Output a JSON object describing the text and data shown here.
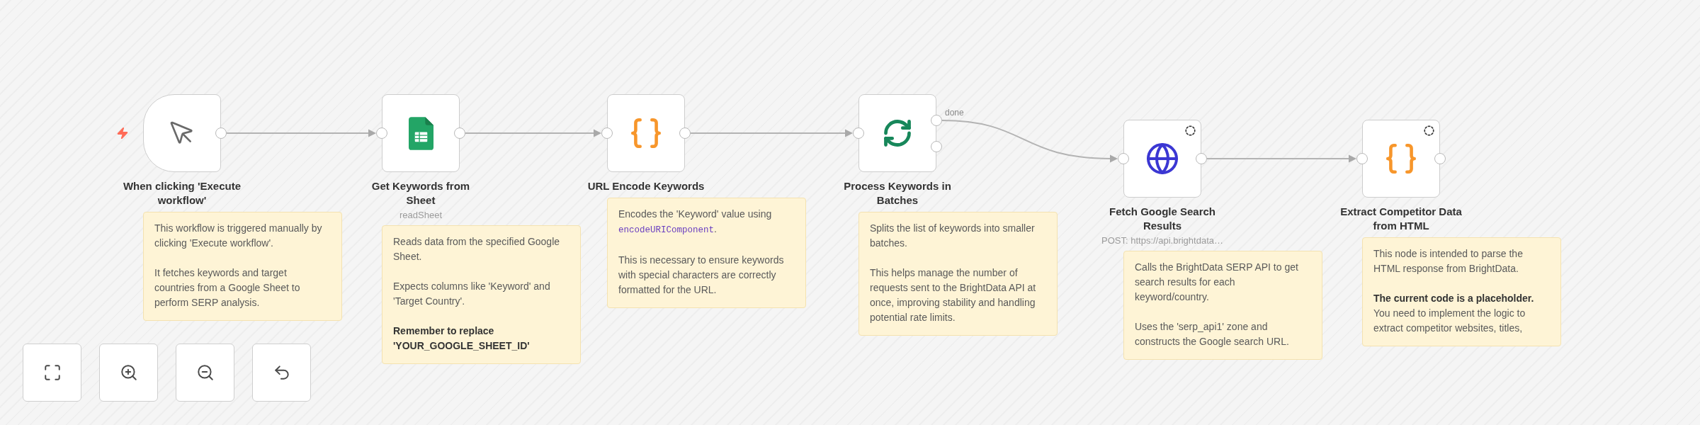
{
  "nodes": [
    {
      "kind": "trigger",
      "label": "When clicking 'Execute workflow'",
      "indicator": false,
      "note": [
        {
          "bold": false,
          "runs": [
            {
              "kind": "text",
              "text": "This workflow is triggered manually by clicking 'Execute workflow'."
            }
          ]
        },
        {
          "bold": false,
          "runs": [
            {
              "kind": "text",
              "text": "It fetches keywords and target countries from a Google Sheet to perform SERP analysis."
            }
          ]
        }
      ]
    },
    {
      "kind": "sheets",
      "label": "Get Keywords from Sheet",
      "subtitle": "readSheet",
      "indicator": false,
      "note": [
        {
          "bold": false,
          "runs": [
            {
              "kind": "text",
              "text": "Reads data from the specified Google Sheet."
            }
          ]
        },
        {
          "bold": false,
          "runs": [
            {
              "kind": "text",
              "text": "Expects columns like 'Keyword' and 'Target Country'."
            }
          ]
        },
        {
          "bold": true,
          "runs": [
            {
              "kind": "text",
              "text": "Remember to replace 'YOUR_GOOGLE_SHEET_ID'"
            }
          ]
        }
      ]
    },
    {
      "kind": "code",
      "label": "URL Encode Keywords",
      "indicator": false,
      "note": [
        {
          "bold": false,
          "runs": [
            {
              "kind": "text",
              "text": "Encodes the 'Keyword' value using "
            },
            {
              "kind": "code",
              "text": "encodeURIComponent"
            },
            {
              "kind": "text",
              "text": "."
            }
          ]
        },
        {
          "bold": false,
          "runs": [
            {
              "kind": "text",
              "text": "This is necessary to ensure keywords with special characters are correctly formatted for the URL."
            }
          ]
        }
      ]
    },
    {
      "kind": "batches",
      "label": "Process Keywords in Batches",
      "output_label": "done",
      "indicator": false,
      "note": [
        {
          "bold": false,
          "runs": [
            {
              "kind": "text",
              "text": "Splits the list of keywords into smaller batches."
            }
          ]
        },
        {
          "bold": false,
          "runs": [
            {
              "kind": "text",
              "text": "This helps manage the number of requests sent to the BrightData API at once, improving stability and handling potential rate limits."
            }
          ]
        }
      ]
    },
    {
      "kind": "http",
      "label": "Fetch Google Search Results",
      "subtitle": "POST: https://api.brightdata…",
      "indicator": true,
      "note": [
        {
          "bold": false,
          "runs": [
            {
              "kind": "text",
              "text": "Calls the BrightData SERP API to get search results for each keyword/country."
            }
          ]
        },
        {
          "bold": false,
          "runs": [
            {
              "kind": "text",
              "text": "Uses the 'serp_api1' zone and constructs the Google search URL."
            }
          ]
        }
      ]
    },
    {
      "kind": "code",
      "label": "Extract Competitor Data from HTML",
      "indicator": true,
      "note": [
        {
          "bold": false,
          "runs": [
            {
              "kind": "text",
              "text": "This node is intended to parse the HTML response from BrightData."
            }
          ]
        },
        {
          "bold": false,
          "runs": [
            {
              "kind": "text",
              "text": "**The current code is a placeholder.** You need to implement the logic to extract competitor websites, titles,"
            }
          ]
        }
      ]
    }
  ],
  "canvas_controls": [
    {
      "kind": "fit_view"
    },
    {
      "kind": "zoom_in"
    },
    {
      "kind": "zoom_out"
    },
    {
      "kind": "reset_zoom"
    }
  ]
}
